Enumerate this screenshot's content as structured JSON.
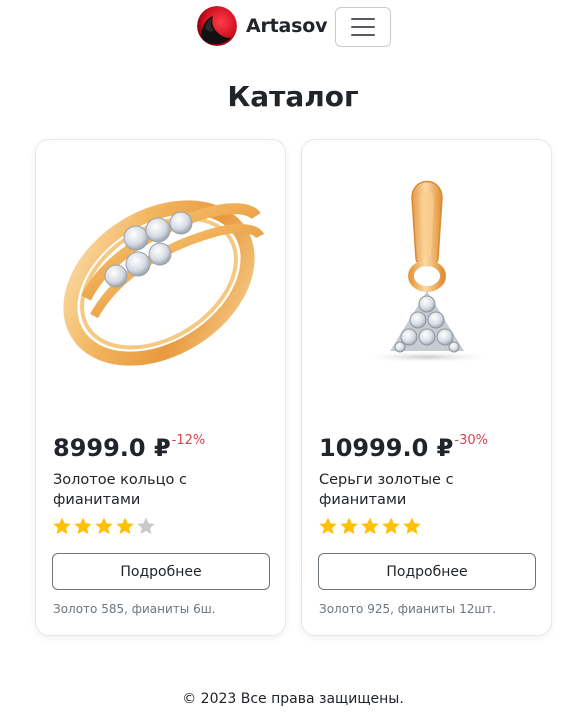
{
  "header": {
    "brand": "Artasov",
    "logo_icon": "red-moon-avatar-icon",
    "menu_icon": "hamburger-menu-icon"
  },
  "page": {
    "title": "Каталог"
  },
  "products": [
    {
      "price": "8999.0 ₽",
      "discount": "-12%",
      "name": "Золотое кольцо с фианитами",
      "rating": 4,
      "rating_max": 5,
      "button": "Подробнее",
      "composition": "Золото 585, фианиты 6ш.",
      "image_icon": "gold-ring-image"
    },
    {
      "price": "10999.0 ₽",
      "discount": "-30%",
      "name": "Серьги золотые с фианитами",
      "rating": 5,
      "rating_max": 5,
      "button": "Подробнее",
      "composition": "Золото 925, фианиты 12шт.",
      "image_icon": "gold-pendant-image"
    }
  ],
  "footer": {
    "text": "© 2023 Все права защищены."
  },
  "colors": {
    "star_filled": "#ffc107",
    "star_empty": "#c7c9cc",
    "discount": "#d9414b",
    "text": "#212529",
    "muted": "#6c757d"
  }
}
